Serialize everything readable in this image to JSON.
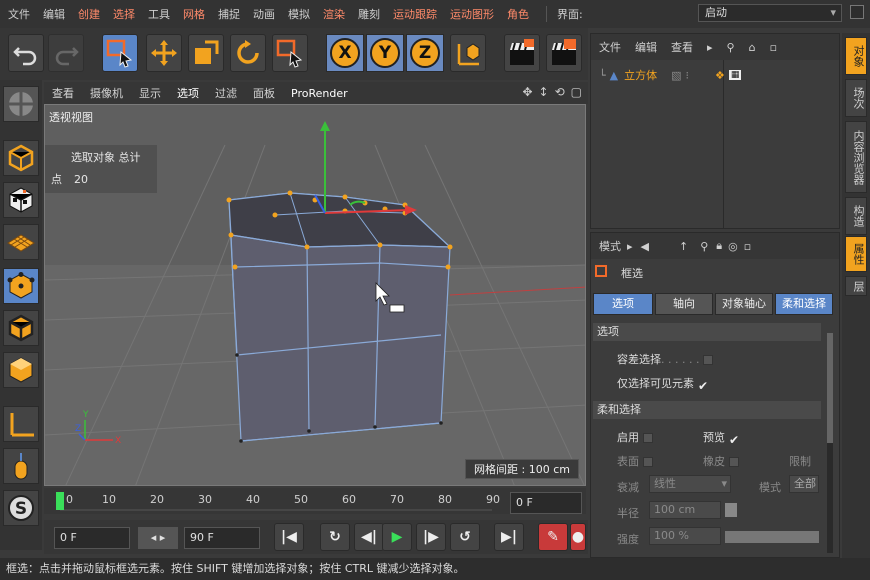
{
  "menubar": {
    "items": [
      "文件",
      "编辑",
      "创建",
      "选择",
      "工具",
      "网格",
      "捕捉",
      "动画",
      "模拟",
      "渲染",
      "雕刻",
      "运动跟踪",
      "运动图形",
      "角色"
    ],
    "layout_label": "界面:",
    "layout_value": "启动"
  },
  "viewport": {
    "menu": [
      "查看",
      "摄像机",
      "显示",
      "选项",
      "过滤",
      "面板",
      "ProRender"
    ],
    "title": "透视视图",
    "hud_header": "选取对象  总计",
    "hud_row_label": "点",
    "hud_row_value": "20",
    "grid_info": "网格间距 : 100 cm"
  },
  "timeline": {
    "ticks": [
      "0",
      "10",
      "20",
      "30",
      "40",
      "50",
      "60",
      "70",
      "80",
      "90"
    ],
    "frame_field": "0 F"
  },
  "transport": {
    "start_field": "0 F",
    "end_field": "90 F"
  },
  "object_manager": {
    "menu": [
      "文件",
      "编辑",
      "查看"
    ],
    "object_name": "立方体"
  },
  "attribute_manager": {
    "menu_label": "模式",
    "tool_name": "框选",
    "tabs": [
      "选项",
      "轴向",
      "对象轴心",
      "柔和选择"
    ],
    "section_options": "选项",
    "prop_tolerant": "容差选择",
    "prop_visible_only": "仅选择可见元素",
    "section_soft": "柔和选择",
    "prop_enable": "启用",
    "prop_preview": "预览",
    "prop_surface": "表面",
    "prop_rubber": "橡皮",
    "prop_limit": "限制",
    "prop_falloff": "衰减",
    "falloff_value": "线性",
    "prop_mode": "模式",
    "mode_value": "全部",
    "prop_radius": "半径",
    "radius_value": "100 cm",
    "prop_strength": "强度",
    "strength_value": "100 %"
  },
  "side_tabs": [
    "对象",
    "场次",
    "内容浏览器",
    "构造",
    "属性",
    "层"
  ],
  "statusbar": {
    "text": "框选：点击并拖动鼠标框选元素。按住 SHIFT 键增加选择对象；按住 CTRL 键减少选择对象。"
  },
  "colors": {
    "accent_blue": "#5a86c8",
    "accent_orange": "#f2a31f",
    "viewport_bg": "#626262"
  }
}
